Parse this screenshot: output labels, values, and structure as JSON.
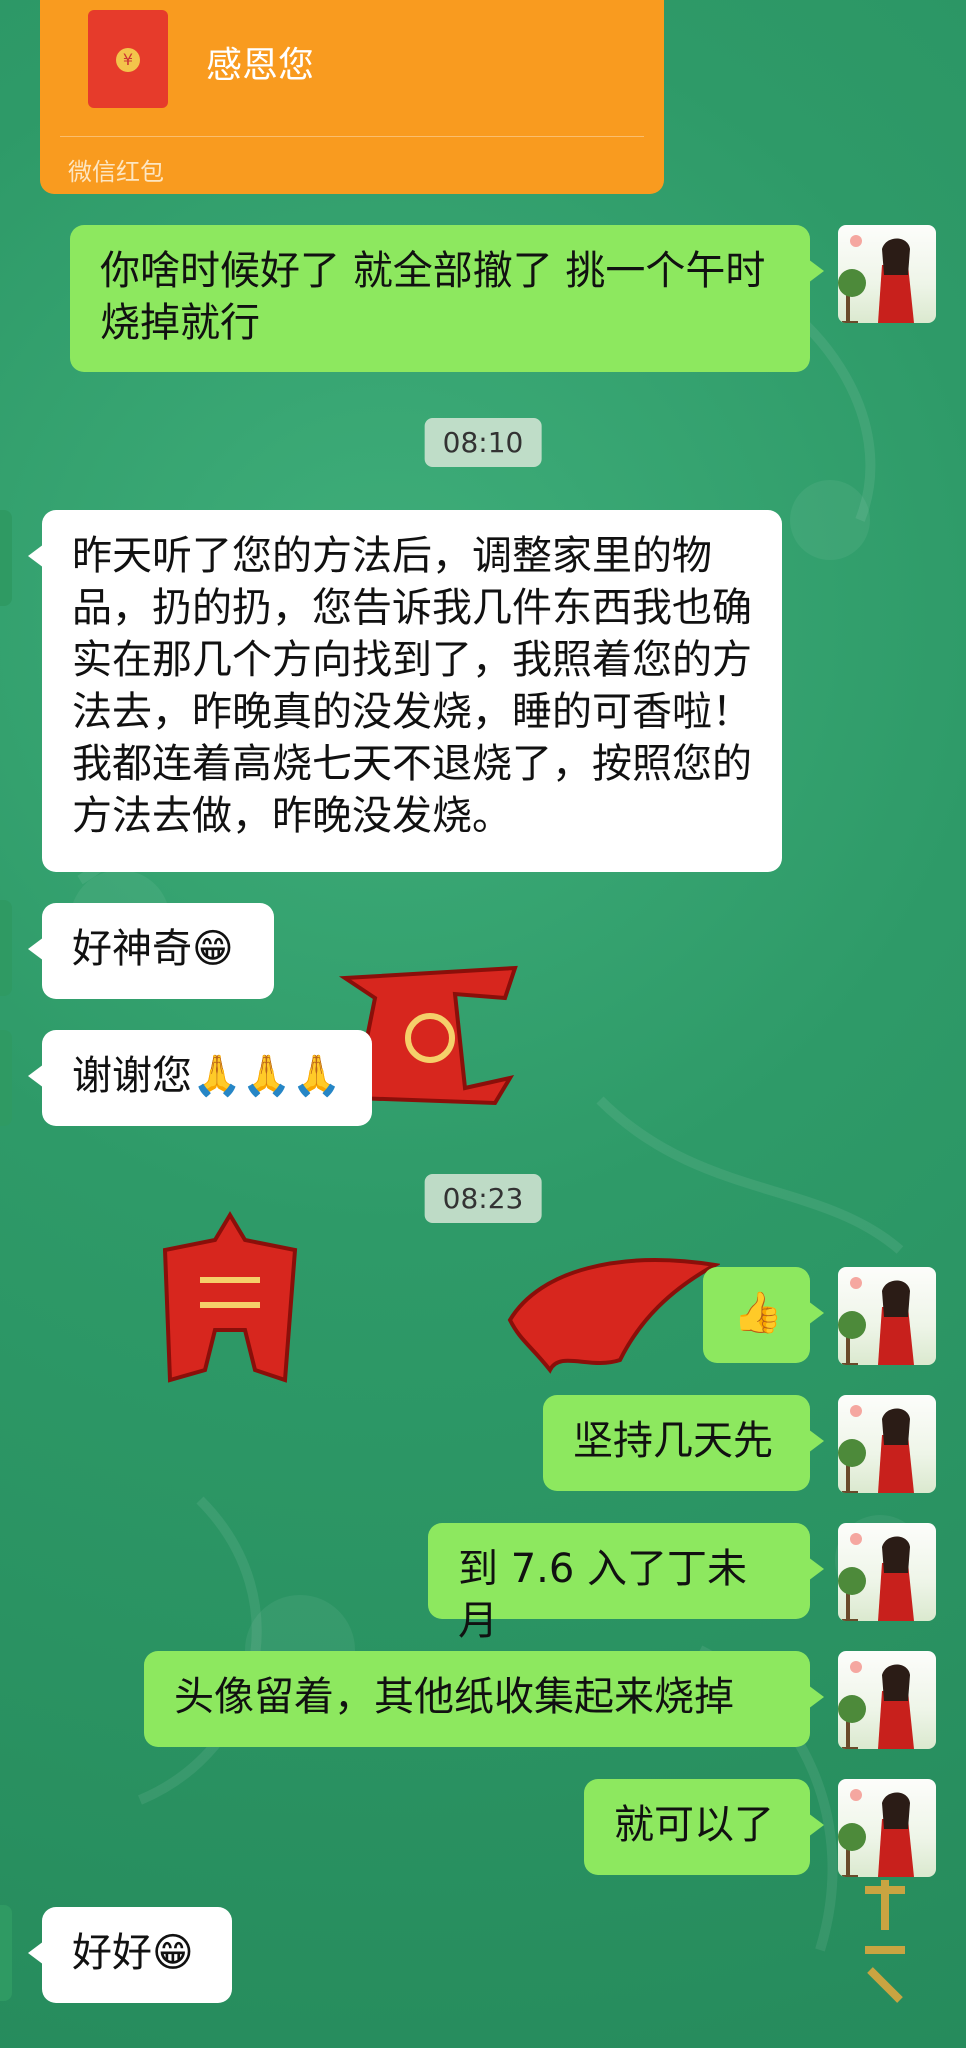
{
  "red_packet": {
    "title": "感恩您",
    "label": "微信红包",
    "icon": "red-packet-icon"
  },
  "timestamps": [
    "08:10",
    "08:23"
  ],
  "messages": [
    {
      "side": "right",
      "text": "你啥时候好了  就全部撤了  挑一个午时  烧掉就行"
    },
    {
      "side": "left",
      "text": "昨天听了您的方法后，调整家里的物品，扔的扔，您告诉我几件东西我也确实在那几个方向找到了，我照着您的方法去，昨晚真的没发烧，睡的可香啦！我都连着高烧七天不退烧了，按照您的方法去做，昨晚没发烧。"
    },
    {
      "side": "left",
      "text": "好神奇😁"
    },
    {
      "side": "left",
      "text": "谢谢您🙏🙏🙏"
    },
    {
      "side": "right",
      "text": "👍"
    },
    {
      "side": "right",
      "text": "坚持几天先"
    },
    {
      "side": "right",
      "text": "到 7.6 入了丁未月"
    },
    {
      "side": "right",
      "text": "头像留着，其他纸收集起来烧掉"
    },
    {
      "side": "right",
      "text": "就可以了"
    },
    {
      "side": "left",
      "text": "好好😁"
    }
  ],
  "colors": {
    "background": "#2e9a68",
    "bubble_right": "#8de85f",
    "bubble_left": "#ffffff",
    "red_packet": "#f99b1f"
  }
}
